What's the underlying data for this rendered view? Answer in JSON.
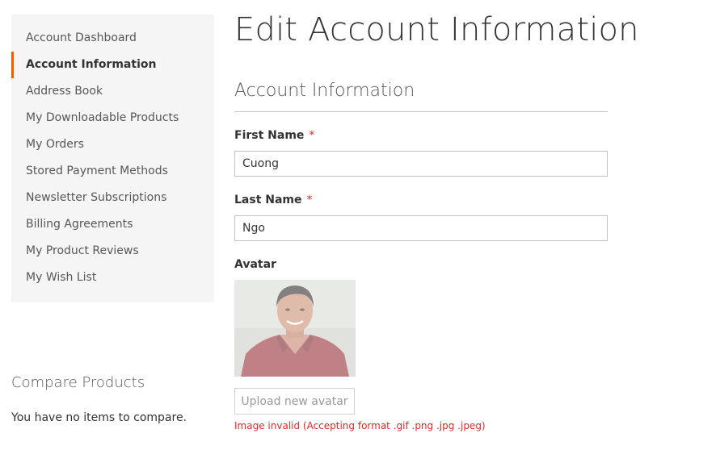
{
  "sidebar": {
    "items": [
      {
        "label": "Account Dashboard",
        "active": false
      },
      {
        "label": "Account Information",
        "active": true
      },
      {
        "label": "Address Book",
        "active": false
      },
      {
        "label": "My Downloadable Products",
        "active": false
      },
      {
        "label": "My Orders",
        "active": false
      },
      {
        "label": "Stored Payment Methods",
        "active": false
      },
      {
        "label": "Newsletter Subscriptions",
        "active": false
      },
      {
        "label": "Billing Agreements",
        "active": false
      },
      {
        "label": "My Product Reviews",
        "active": false
      },
      {
        "label": "My Wish List",
        "active": false
      }
    ]
  },
  "compare": {
    "title": "Compare Products",
    "empty_text": "You have no items to compare."
  },
  "main": {
    "page_title": "Edit Account Information",
    "section_title": "Account Information",
    "first_name": {
      "label": "First Name",
      "required_mark": "*",
      "value": "Cuong"
    },
    "last_name": {
      "label": "Last Name",
      "required_mark": "*",
      "value": "Ngo"
    },
    "avatar": {
      "label": "Avatar",
      "upload_label": "Upload new avatar",
      "error": "Image invalid (Accepting format .gif .png .jpg .jpeg)"
    }
  },
  "colors": {
    "accent": "#ff5501",
    "error": "#e02b27",
    "sidebar_bg": "#f5f5f5"
  },
  "icons": []
}
